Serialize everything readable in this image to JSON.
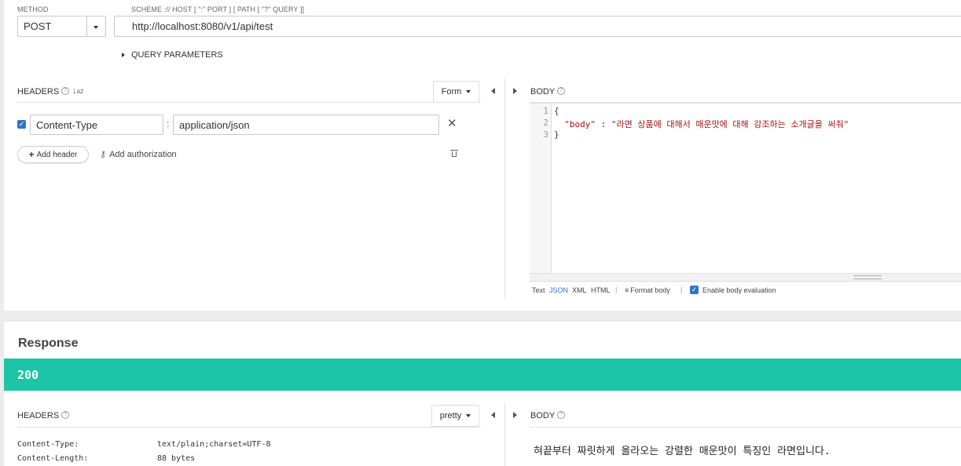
{
  "request": {
    "method_label": "METHOD",
    "method_value": "POST",
    "url_label": "SCHEME :// HOST [ \":\" PORT ] [ PATH [ \"?\" QUERY ]]",
    "url_value": "http://localhost:8080/v1/api/test",
    "query_parameters_label": "QUERY PARAMETERS",
    "headers_label": "HEADERS",
    "headers_mode": "Form",
    "header_rows": [
      {
        "checked": true,
        "name": "Content-Type",
        "separator": ":",
        "value": "application/json"
      }
    ],
    "add_header_label": "Add header",
    "add_authorization_label": "Add authorization",
    "body_label": "BODY",
    "body_lines": [
      {
        "num": "1",
        "text": "{"
      },
      {
        "num": "2",
        "key": "\"body\"",
        "sep": " : ",
        "value": "\"라면 상품에 대해서 매운맛에 대해 강조하는 소개글을 써줘\""
      },
      {
        "num": "3",
        "text": "}"
      }
    ],
    "body_formats": [
      "Text",
      "JSON",
      "XML",
      "HTML"
    ],
    "active_format": "JSON",
    "format_body_label": "Format body",
    "enable_eval_label": "Enable body evaluation",
    "enable_eval_checked": true
  },
  "response": {
    "title": "Response",
    "status_code": "200",
    "status_color": "#1dc5a6",
    "headers_label": "HEADERS",
    "headers_mode": "pretty",
    "header_rows": [
      {
        "name": "Content-Type:",
        "value": "text/plain;charset=UTF-8"
      },
      {
        "name": "Content-Length:",
        "value": "88 bytes"
      }
    ],
    "body_label": "BODY",
    "body_text": "혀끝부터 짜릿하게 올라오는 강렬한 매운맛이 특징인 라면입니다."
  },
  "colors": {
    "accent_blue": "#2d76c9",
    "json_key": "#a11",
    "json_string": "#a11"
  }
}
